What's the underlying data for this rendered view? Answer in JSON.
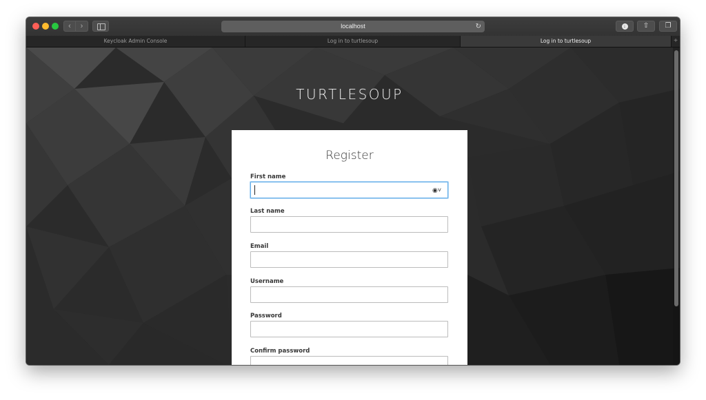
{
  "browser": {
    "url": "localhost",
    "tabs": [
      {
        "label": "Keycloak Admin Console",
        "active": false
      },
      {
        "label": "Log in to turtlesoup",
        "active": false
      },
      {
        "label": "Log in to turtlesoup",
        "active": true
      }
    ],
    "new_tab_symbol": "+",
    "icons": {
      "back": "chevron-left-icon",
      "forward": "chevron-right-icon",
      "sidebar": "sidebar-icon",
      "reload": "reload-icon",
      "download": "download-icon",
      "share": "share-icon",
      "tab_overview": "tab-overview-icon"
    }
  },
  "page": {
    "brand": "TURTLESOUP",
    "form_title": "Register",
    "fields": [
      {
        "label": "First name",
        "value": "",
        "focused": true
      },
      {
        "label": "Last name",
        "value": "",
        "focused": false
      },
      {
        "label": "Email",
        "value": "",
        "focused": false
      },
      {
        "label": "Username",
        "value": "",
        "focused": false
      },
      {
        "label": "Password",
        "value": "",
        "focused": false
      },
      {
        "label": "Confirm password",
        "value": "",
        "focused": false
      }
    ],
    "autofill_icon": "contact-autofill-icon"
  },
  "colors": {
    "focus_ring": "#66afe9",
    "background_dark": "#232323",
    "card": "#ffffff"
  }
}
